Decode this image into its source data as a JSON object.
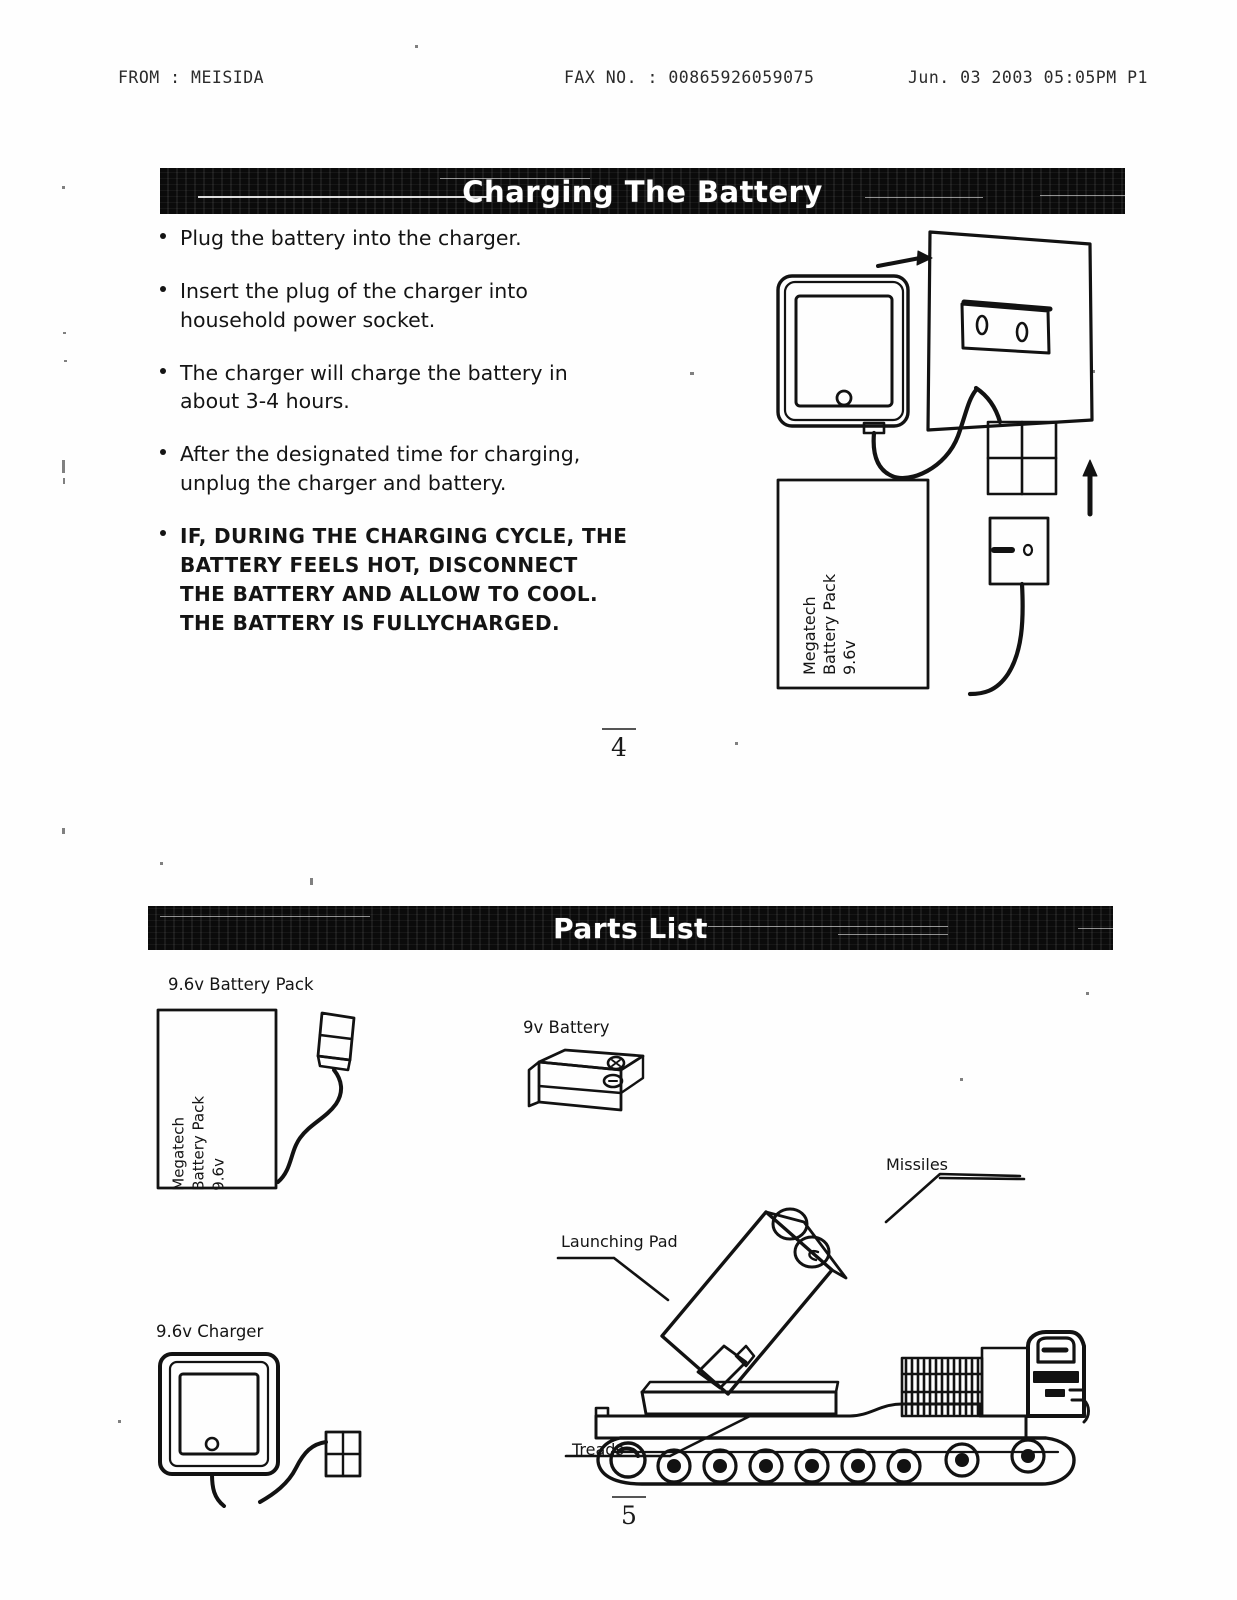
{
  "fax_header": {
    "from": "FROM : MEISIDA",
    "fax_no": "FAX NO.  :  00865926059075",
    "date": "Jun. 03 2003 05:05PM P1"
  },
  "sections": {
    "charging": {
      "banner_title": "Charging The Battery",
      "page_number": "4",
      "bullets": [
        {
          "text": "Plug the battery into the charger.",
          "bold": false
        },
        {
          "text": "Insert the plug of the charger into household power socket.",
          "bold": false
        },
        {
          "text": "The charger will charge the battery in about 3-4 hours.",
          "bold": false
        },
        {
          "text": "After the designated time for charging, unplug the charger and battery.",
          "bold": false
        },
        {
          "text": "IF, DURING THE CHARGING CYCLE, THE BATTERY FEELS HOT, DISCONNECT THE BATTERY AND ALLOW TO COOL. THE BATTERY IS FULLYCHARGED.",
          "bold": true
        }
      ],
      "diagram": {
        "battery_pack_label_line1": "Megatech",
        "battery_pack_label_line2": "Battery Pack",
        "battery_pack_label_line3": "9.6v"
      }
    },
    "parts": {
      "banner_title": "Parts List",
      "page_number": "5",
      "items": [
        {
          "label": "9.6v Battery Pack"
        },
        {
          "label": "9v Battery"
        },
        {
          "label": "9.6v Charger"
        }
      ],
      "battery_pack_face": {
        "line1": "Megatech",
        "line2": "Battery Pack",
        "line3": "9.6v"
      },
      "vehicle_callouts": [
        {
          "label": "Missiles"
        },
        {
          "label": "Launching Pad"
        },
        {
          "label": "Treads"
        }
      ]
    }
  },
  "colors": {
    "ink": "#141414",
    "banner_bg": "#0b0b0b",
    "banner_text": "#ffffff",
    "paper": "#fefefe"
  }
}
